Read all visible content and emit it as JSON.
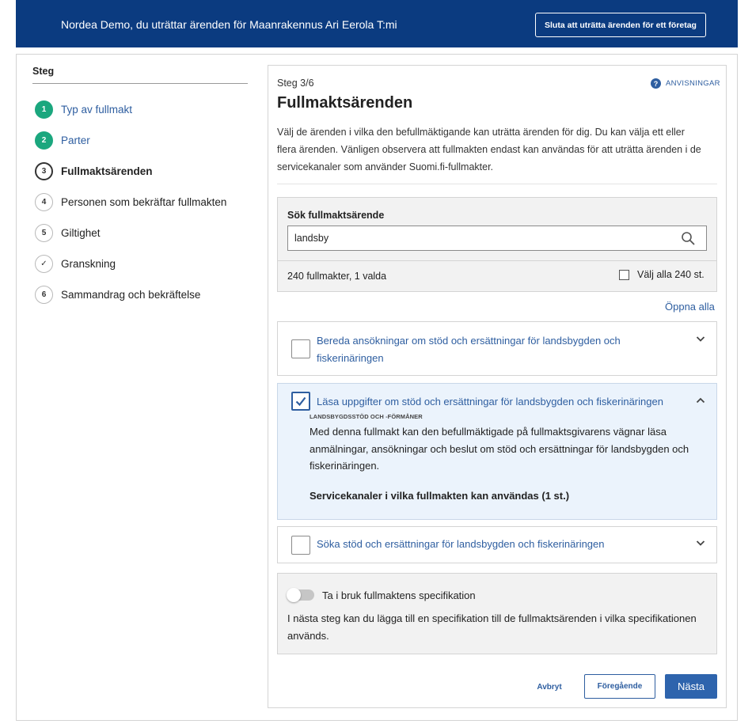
{
  "banner": {
    "text": "Nordea Demo, du uträttar ärenden för Maanrakennus Ari Eerola T:mi",
    "stop_button": "Sluta att uträtta ärenden för ett företag"
  },
  "sidebar": {
    "title": "Steg",
    "steps": [
      {
        "number": "1",
        "label": "Typ av fullmakt",
        "state": "done"
      },
      {
        "number": "2",
        "label": "Parter",
        "state": "done"
      },
      {
        "number": "3",
        "label": "Fullmaktsärenden",
        "state": "current"
      },
      {
        "number": "4",
        "label": "Personen som bekräftar fullmakten",
        "state": "pending"
      },
      {
        "number": "5",
        "label": "Giltighet",
        "state": "pending"
      },
      {
        "number": "✓",
        "label": "Granskning",
        "state": "pending"
      },
      {
        "number": "6",
        "label": "Sammandrag och bekräftelse",
        "state": "pending"
      }
    ]
  },
  "main": {
    "step_count": "Steg 3/6",
    "help_link": "ANVISNINGAR",
    "title": "Fullmaktsärenden",
    "intro": "Välj de ärenden i vilka den befullmäktigande kan uträtta ärenden för dig. Du kan välja ett eller flera ärenden. Vänligen observera att fullmakten endast kan användas för att uträtta ärenden i de servicekanaler som använder Suomi.fi-fullmakter."
  },
  "search": {
    "label": "Sök fullmaktsärende",
    "value": "landsby",
    "result_count": "240 fullmakter, 1 valda",
    "select_all": "Välj alla 240 st."
  },
  "open_all": "Öppna alla",
  "items": [
    {
      "title": "Bereda ansökningar om stöd och ersättningar för landsbygden och fiskerinäringen",
      "checked": false,
      "expanded": false
    },
    {
      "title": "Läsa uppgifter om stöd och ersättningar för landsbygden och fiskerinäringen",
      "checked": true,
      "expanded": true,
      "category": "LANDSBYGDSSTÖD OCH -FÖRMÅNER",
      "description": "Med denna fullmakt kan den befullmäktigade på fullmaktsgivarens vägnar läsa anmälningar, ansökningar och beslut om stöd och ersättningar för landsbygden och fiskerinäringen.",
      "channels_heading": "Servicekanaler i vilka fullmakten kan användas (1 st.)"
    },
    {
      "title": "Söka stöd och ersättningar för landsbygden och fiskerinäringen",
      "checked": false,
      "expanded": false
    }
  ],
  "specification": {
    "toggle_label": "Ta i bruk fullmaktens specifikation",
    "toggle_on": false,
    "description": "I nästa steg kan du lägga till en specifikation till de fullmaktsärenden i vilka specifikationen används."
  },
  "footer": {
    "cancel": "Avbryt",
    "previous": "Föregående",
    "next": "Nästa"
  },
  "colors": {
    "banner": "#0b3b80",
    "link": "#2e5ea0",
    "step_done": "#1ba77e",
    "primary_button": "#2e64ad",
    "selected_bg": "#ebf3fc"
  }
}
